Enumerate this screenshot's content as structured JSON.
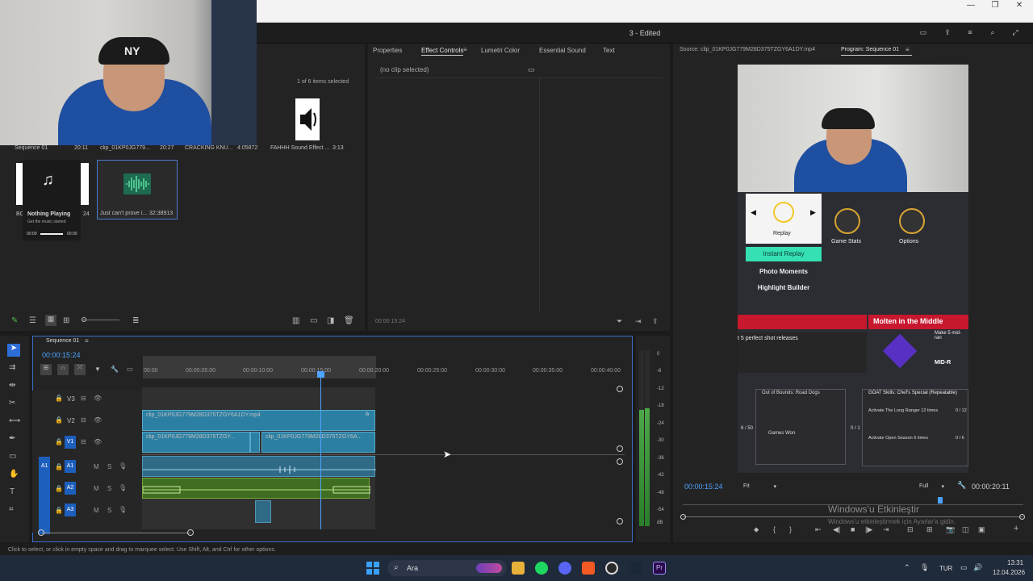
{
  "window": {
    "title": "3 - Edited",
    "minimize": "—",
    "restore": "❐",
    "close": "✕"
  },
  "project": {
    "count": "1 of 6 items selected",
    "items": [
      {
        "name": "Sequence 01",
        "dur": "20:11"
      },
      {
        "name": "clip_01KP0JG779...",
        "dur": "20:27"
      },
      {
        "name": "CRACKING KNU...",
        "dur": "4:05872"
      },
      {
        "name": "FAHHH Sound Effect ...",
        "dur": "3:13"
      },
      {
        "name": "BO",
        "dur": "24"
      },
      {
        "name": "Just can't prove i...",
        "dur": "32:38913"
      }
    ],
    "music": {
      "title": "Nothing Playing",
      "subtitle": "Get the music started",
      "t1": "00:00",
      "t2": "00:00"
    }
  },
  "effect_tabs": [
    "Properties",
    "Effect Controls",
    "Lumetri Color",
    "Essential Sound",
    "Text"
  ],
  "effect": {
    "noclip": "(no clip selected)",
    "time": "00:00:15:24"
  },
  "program": {
    "source": "Source: clip_01KP0JG779M28D375TZGY6A1DY.mp4",
    "label": "Program: Sequence 01",
    "time": "00:00:15:24",
    "fit": "Fit",
    "full": "Full",
    "duration": "00:00:20:11",
    "watermark1": "Windows'u Etkinleştir",
    "watermark2": "Windows'u etkinleştirmek için Ayarlar'a gidin."
  },
  "game": {
    "replay": "Replay",
    "stats": "Game Stats",
    "options": "Options",
    "menu": [
      "Instant Replay",
      "Photo Moments",
      "Highlight Builder"
    ],
    "banner": "Molten in the Middle",
    "shot": "t 5 perfect shot releases",
    "make": "Make 5 mid-ran",
    "mid": "MID-R",
    "ob": "Out of Bounds: Road Dogs",
    "won": "Games Won",
    "frac1": "6 / 50",
    "frac2": "0 / 1",
    "goat": "GOAT Skills: Chef's Special (Repeatable)",
    "t1": "Activate The Long Ranger 12 times",
    "f1": "0 / 12",
    "t2": "Activate Open Season 6 times",
    "f2": "0 / 6"
  },
  "timeline": {
    "seq": "Sequence 01",
    "time": "00:00:15:24",
    "ruler": [
      "00:00",
      "00:00:05:00",
      "00:00:10:00",
      "00:00:15:00",
      "00:00:20:00",
      "00:00:25:00",
      "00:00:30:00",
      "00:00:35:00",
      "00:00:40:00"
    ],
    "tracks": [
      "V3",
      "V2",
      "V1",
      "A1",
      "A2",
      "A3"
    ],
    "clip_v2": "clip_01KP0JG779M28D375TZGY6A1DY.mp4",
    "clip_v1a": "clip_01KP0JG779M28D375TZGY...",
    "clip_v1b": "clip_01KP0JG779M28D375TZGY6A..."
  },
  "meter": [
    "0",
    "-6",
    "-12",
    "-18",
    "-24",
    "-30",
    "-36",
    "-42",
    "-48",
    "-54",
    "dB"
  ],
  "status": "Click to select, or click in empty space and drag to marquee select. Use Shift, Alt, and Ctrl for other options.",
  "taskbar": {
    "search": "Ara",
    "lang": "TUR",
    "time": "13:31",
    "date": "12.04.2026"
  }
}
